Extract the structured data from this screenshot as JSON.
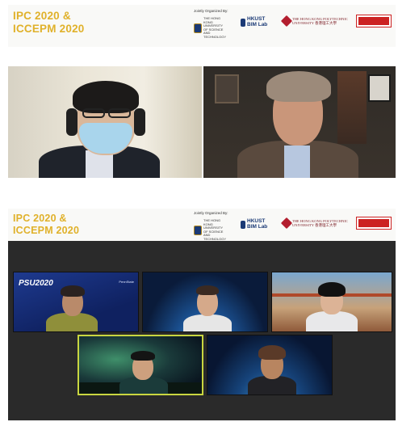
{
  "event": {
    "title_line1": "IPC 2020 &",
    "title_line2": "ICCEPM 2020",
    "organized_label": "Jointly Organized By:"
  },
  "organizers": {
    "hkust": "THE HONG KONG UNIVERSITY OF SCIENCE AND TECHNOLOGY",
    "bim_line1": "HKUST",
    "bim_line2": "BIM Lab",
    "polyu": "THE HONG KONG POLYTECHNIC UNIVERSITY 香港理工大學"
  },
  "gallery": {
    "psu_title": "PSU2020",
    "psu_badge": "PennState"
  },
  "colors": {
    "title_gold": "#e0b12a",
    "active_speaker_border": "#c9d640",
    "dark_background": "#2a2a2a"
  }
}
